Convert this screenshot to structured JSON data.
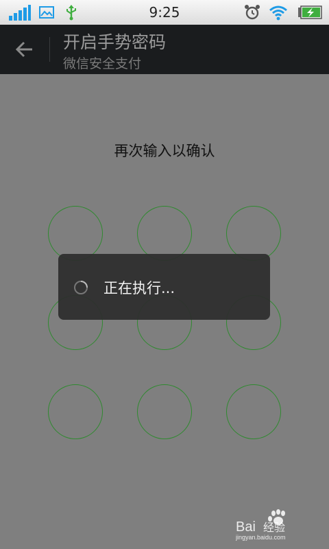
{
  "status_bar": {
    "time": "9:25",
    "icons": [
      "signal-icon",
      "image-icon",
      "usb-icon",
      "alarm-icon",
      "wifi-icon",
      "battery-charging-icon"
    ]
  },
  "action_bar": {
    "title": "开启手势密码",
    "subtitle": "微信安全支付",
    "back_icon": "arrow-left-icon"
  },
  "gesture": {
    "prompt": "再次输入以确认",
    "dot_color": "#2f8a2f",
    "dots": 9
  },
  "dialog": {
    "message": "正在执行..."
  },
  "watermark": {
    "brand": "Bai经验",
    "url": "jingyan.baidu.com"
  },
  "colors": {
    "overlay_bg": "#7f7f7f",
    "action_bar_bg": "#1a1c1e",
    "accent_blue": "#1e9be6"
  }
}
